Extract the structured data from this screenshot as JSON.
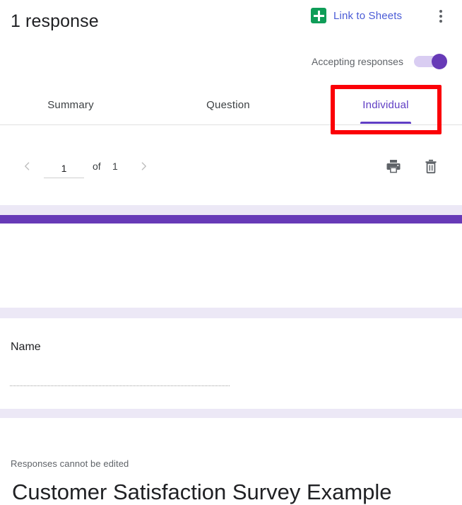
{
  "header": {
    "response_count": "1 response",
    "link_to_sheets_label": "Link to Sheets",
    "sheets_icon": "google-sheets-icon",
    "overflow_icon": "more-vert-icon",
    "accepting_responses_label": "Accepting responses",
    "toggle_state": "on"
  },
  "tabs": [
    {
      "label": "Summary",
      "active": false
    },
    {
      "label": "Question",
      "active": false
    },
    {
      "label": "Individual",
      "active": true
    }
  ],
  "annotation": {
    "target": "Individual",
    "color": "#fb0007"
  },
  "pagination": {
    "prev_icon": "chevron-left-icon",
    "next_icon": "chevron-right-icon",
    "current_page": "1",
    "page_placeholder": "1",
    "of_label": "of",
    "total_pages": "1",
    "print_icon": "print-icon",
    "delete_icon": "trash-icon"
  },
  "form": {
    "notice": "Responses cannot be edited",
    "title": "Customer Satisfaction Survey Example",
    "accent_color": "#673ab7",
    "band_color": "#ece8f6",
    "questions": [
      {
        "label": "Name",
        "answer": ""
      }
    ]
  }
}
